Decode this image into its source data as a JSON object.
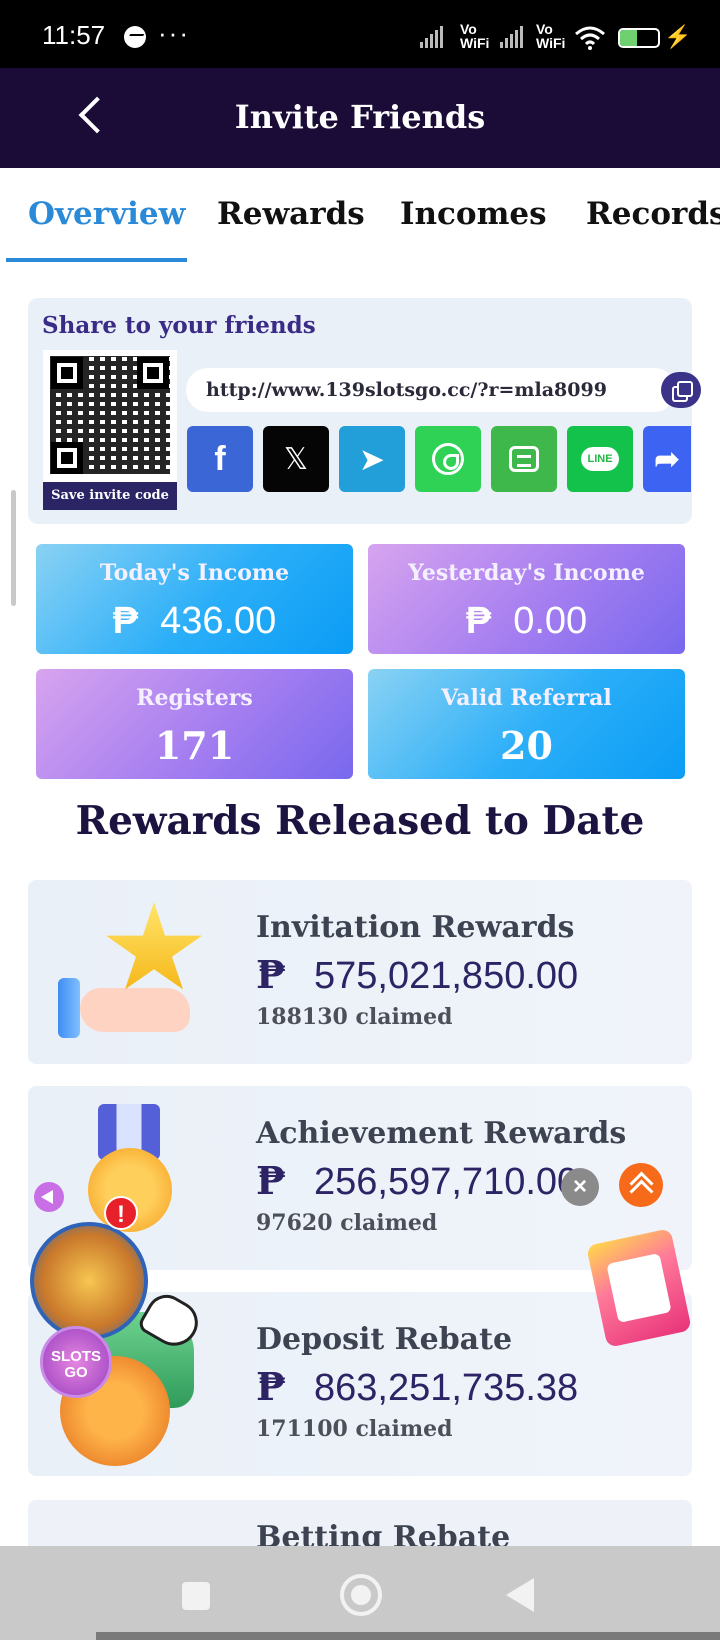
{
  "status_bar": {
    "time": "11:57",
    "dots": "···",
    "vowifi_1": "Vo\nWiFi",
    "vowifi_2": "Vo\nWiFi",
    "battery": "46"
  },
  "header": {
    "title": "Invite Friends"
  },
  "tabs": [
    {
      "label": "Overview",
      "active": true
    },
    {
      "label": "Rewards",
      "active": false
    },
    {
      "label": "Incomes",
      "active": false
    },
    {
      "label": "Records",
      "active": false
    }
  ],
  "share": {
    "title": "Share to your friends",
    "save_code_label": "Save invite code",
    "invite_link": "http://www.139slotsgo.cc/?r=mla8099",
    "buttons": [
      {
        "name": "facebook",
        "glyph": "f",
        "color": "#3b67d6"
      },
      {
        "name": "x",
        "glyph": "𝕏",
        "color": "#050505"
      },
      {
        "name": "telegram",
        "glyph": "➤",
        "color": "#229ed9"
      },
      {
        "name": "whatsapp",
        "glyph": "",
        "color": "#2fd254"
      },
      {
        "name": "sms",
        "glyph": "",
        "color": "#3fb84b"
      },
      {
        "name": "line",
        "glyph": "LINE",
        "color": "#13c24a"
      },
      {
        "name": "more-share",
        "glyph": "➦",
        "color": "#3d63f2"
      }
    ]
  },
  "stats": {
    "currency": "₱",
    "today_label": "Today's Income",
    "today_value": "436.00",
    "yesterday_label": "Yesterday's Income",
    "yesterday_value": "0.00",
    "registers_label": "Registers",
    "registers_value": "171",
    "valid_label": "Valid Referral",
    "valid_value": "20"
  },
  "released": {
    "title": "Rewards Released to Date",
    "items": [
      {
        "name": "Invitation Rewards",
        "amount": "575,021,850.00",
        "claimed": "188130 claimed"
      },
      {
        "name": "Achievement Rewards",
        "amount": "256,597,710.00",
        "claimed": "97620 claimed"
      },
      {
        "name": "Deposit Rebate",
        "amount": "863,251,735.38",
        "claimed": "171100 claimed"
      },
      {
        "name": "Betting Rebate"
      }
    ]
  },
  "floating": {
    "badge": "!",
    "slots_label": "SLOTS\nGO",
    "close": "×"
  },
  "colors": {
    "header_bg": "#1b0c37",
    "tab_active": "#2a8ad8",
    "accent_orange": "#f76a1a"
  }
}
